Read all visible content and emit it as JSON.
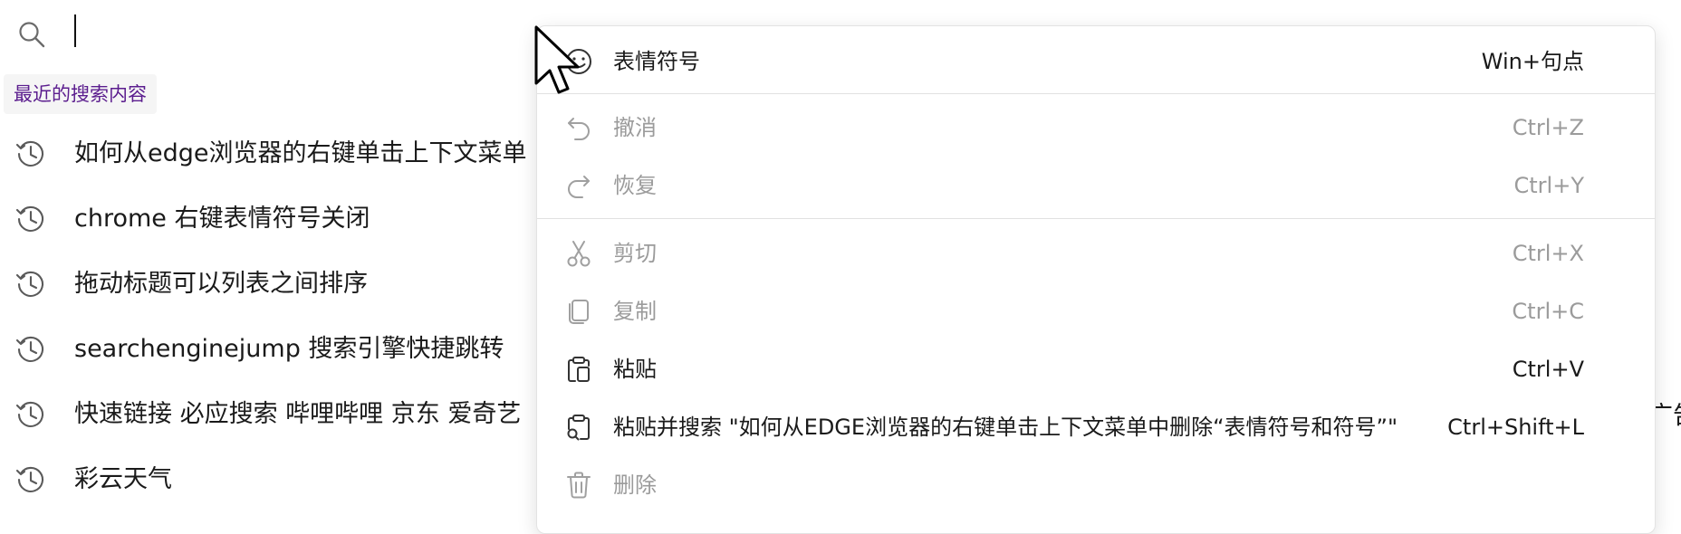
{
  "search": {
    "value": ""
  },
  "recent_heading": "最近的搜索内容",
  "history": [
    "如何从edge浏览器的右键单击上下文菜单",
    "chrome 右键表情符号关闭",
    "拖动标题可以列表之间排序",
    "searchenginejump 搜索引擎快捷跳转",
    "快速链接 必应搜索 哔哩哔哩 京东 爱奇艺",
    "彩云天气"
  ],
  "side_fragment": "广告",
  "context_menu": {
    "items": [
      {
        "label": "表情符号",
        "shortcut": "Win+句点",
        "icon": "emoji-icon",
        "enabled": true
      },
      {
        "label": "撤消",
        "shortcut": "Ctrl+Z",
        "icon": "undo-icon",
        "enabled": false
      },
      {
        "label": "恢复",
        "shortcut": "Ctrl+Y",
        "icon": "redo-icon",
        "enabled": false
      },
      {
        "label": "剪切",
        "shortcut": "Ctrl+X",
        "icon": "cut-icon",
        "enabled": false
      },
      {
        "label": "复制",
        "shortcut": "Ctrl+C",
        "icon": "copy-icon",
        "enabled": false
      },
      {
        "label": "粘贴",
        "shortcut": "Ctrl+V",
        "icon": "paste-icon",
        "enabled": true
      },
      {
        "label": "粘贴并搜索 \"如何从EDGE浏览器的右键单击上下文菜单中删除“表情符号和符号”\"",
        "shortcut": "Ctrl+Shift+L",
        "icon": "paste-search-icon",
        "enabled": true
      },
      {
        "label": "删除",
        "shortcut": "",
        "icon": "delete-icon",
        "enabled": false
      }
    ]
  },
  "colors": {
    "accent_purple": "#5b1d8e",
    "disabled_text": "#9b9b9b",
    "text": "#1a1a1a"
  }
}
